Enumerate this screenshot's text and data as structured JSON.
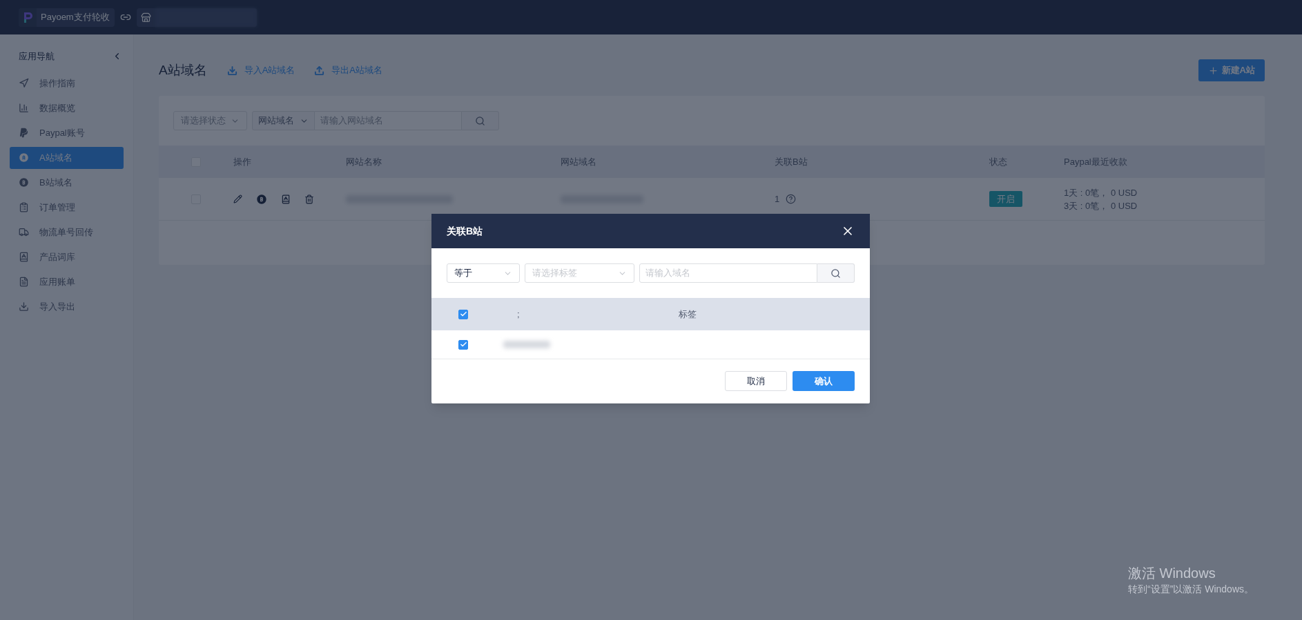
{
  "topbar": {
    "app_name": "Payoem支付轮收"
  },
  "sidebar": {
    "title": "应用导航",
    "items": [
      {
        "label": "操作指南",
        "selected": false
      },
      {
        "label": "数据概览",
        "selected": false
      },
      {
        "label": "Paypal账号",
        "selected": false
      },
      {
        "label": "A站域名",
        "selected": true
      },
      {
        "label": "B站域名",
        "selected": false
      },
      {
        "label": "订单管理",
        "selected": false
      },
      {
        "label": "物流单号回传",
        "selected": false
      },
      {
        "label": "产品词库",
        "selected": false
      },
      {
        "label": "应用账单",
        "selected": false
      },
      {
        "label": "导入导出",
        "selected": false
      }
    ]
  },
  "page": {
    "title": "A站域名",
    "actions": [
      {
        "kind": "import",
        "label": "导入A站域名"
      },
      {
        "kind": "export",
        "label": "导出A站域名"
      }
    ],
    "new_button": "新建A站"
  },
  "filters": {
    "status_placeholder": "请选择状态",
    "field_value": "网站域名",
    "search_placeholder": "请输入网站域名"
  },
  "table": {
    "header_checked": false,
    "columns": [
      "操作",
      "网站名称",
      "网站域名",
      "关联B站",
      "状态",
      "Paypal最近收款"
    ],
    "rows": [
      {
        "checked": false,
        "related_b": "1",
        "status": {
          "label": "开启",
          "on": true
        },
        "payments": [
          "1天 : 0笔， 0 USD",
          "3天 : 0笔， 0 USD"
        ]
      }
    ]
  },
  "modal": {
    "title": "关联B站",
    "operator_value": "等于",
    "tag_placeholder": "请选择标签",
    "search_placeholder": "请输入域名",
    "header_checked": true,
    "columns": [
      ";",
      "标签"
    ],
    "rows": [
      {
        "checked": true
      }
    ],
    "cancel_button": "取消",
    "confirm_button": "确认"
  },
  "os_notice": {
    "title": "激活 Windows",
    "subtitle": "转到“设置”以激活 Windows。"
  }
}
